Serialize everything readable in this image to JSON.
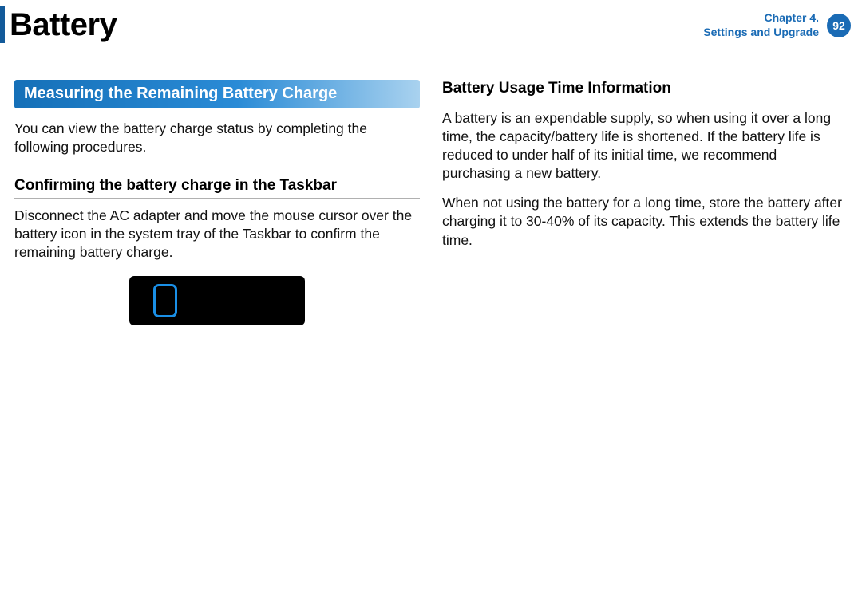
{
  "header": {
    "title": "Battery",
    "chapter_line1": "Chapter 4.",
    "chapter_line2": "Settings and Upgrade",
    "page_number": "92"
  },
  "left": {
    "section_heading": "Measuring the Remaining Battery Charge",
    "intro_para": "You can view the battery charge status by completing the following procedures.",
    "sub_heading": "Confirming the battery charge in the Taskbar",
    "sub_para": "Disconnect the AC adapter and move the mouse cursor over the battery icon in the system tray of the Taskbar to confirm the remaining battery charge."
  },
  "right": {
    "sub_heading": "Battery Usage Time Information",
    "para1": "A battery is an expendable supply, so when using it over a long time, the capacity/battery life is shortened. If the battery life is reduced to under half of its initial time, we recommend purchasing a new battery.",
    "para2": "When not using the battery for a long time, store the battery after charging it to 30-40% of its capacity. This extends the battery life time."
  }
}
